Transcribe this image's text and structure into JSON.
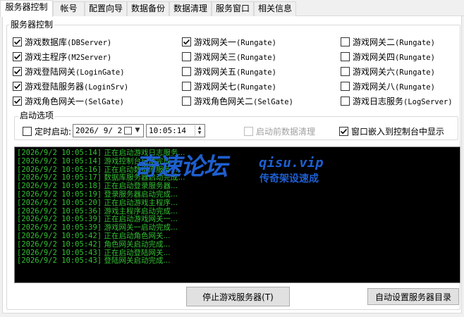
{
  "tabs": [
    {
      "label": "服务器控制"
    },
    {
      "label": "帐号"
    },
    {
      "label": "配置向导"
    },
    {
      "label": "数据备份"
    },
    {
      "label": "数据清理"
    },
    {
      "label": "服务窗口"
    },
    {
      "label": "相关信息"
    }
  ],
  "server_group": {
    "title": "服务器控制",
    "servers": [
      {
        "label": "游戏数据库",
        "code": "(DBServer)",
        "checked": true
      },
      {
        "label": "游戏网关一",
        "code": "(Rungate)",
        "checked": true
      },
      {
        "label": "游戏网关二",
        "code": "(Rungate)",
        "checked": false
      },
      {
        "label": "游戏主程序",
        "code": "(M2Server)",
        "checked": true
      },
      {
        "label": "游戏网关三",
        "code": "(Rungate)",
        "checked": false
      },
      {
        "label": "游戏网关四",
        "code": "(Rungate)",
        "checked": false
      },
      {
        "label": "游戏登陆网关",
        "code": "(LoginGate)",
        "checked": true
      },
      {
        "label": "游戏网关五",
        "code": "(Rungate)",
        "checked": false
      },
      {
        "label": "游戏网关六",
        "code": "(Rungate)",
        "checked": false
      },
      {
        "label": "游戏登陆服务器",
        "code": "(LoginSrv)",
        "checked": true
      },
      {
        "label": "游戏网关七",
        "code": "(Rungate)",
        "checked": false
      },
      {
        "label": "游戏网关八",
        "code": "(Rungate)",
        "checked": false
      },
      {
        "label": "游戏角色网关一",
        "code": "(SelGate)",
        "checked": true
      },
      {
        "label": "游戏角色网关二",
        "code": "(SelGate)",
        "checked": false
      },
      {
        "label": "游戏日志服务",
        "code": "(LogServer)",
        "checked": false
      }
    ]
  },
  "startup": {
    "title": "启动选项",
    "timed_start": {
      "label": "定时启动:",
      "checked": false
    },
    "date_value": "2026/ 9/ 2",
    "time_value": "10:05:14",
    "pre_clean": {
      "label": "启动前数据清理",
      "checked": false,
      "disabled": true
    },
    "embed_window": {
      "label": "窗口嵌入到控制台中显示",
      "checked": true
    }
  },
  "log": [
    {
      "time": "[2026/9/2 10:05:14]",
      "msg": "正在启动游戏日志服务..."
    },
    {
      "time": "[2026/9/2 10:05:14]",
      "msg": "游戏控制台启动完成..."
    },
    {
      "time": "[2026/9/2 10:05:16]",
      "msg": "正在启动数据库服务..."
    },
    {
      "time": "[2026/9/2 10:05:17]",
      "msg": "数据库服务器启动完成..."
    },
    {
      "time": "[2026/9/2 10:05:18]",
      "msg": "正在启动登录服务器..."
    },
    {
      "time": "[2026/9/2 10:05:19]",
      "msg": "登录服务器启动完成..."
    },
    {
      "time": "[2026/9/2 10:05:20]",
      "msg": "正在启动游戏主程序..."
    },
    {
      "time": "[2026/9/2 10:05:36]",
      "msg": "游戏主程序启动完成..."
    },
    {
      "time": "[2026/9/2 10:05:39]",
      "msg": "正在启动游戏网关一..."
    },
    {
      "time": "[2026/9/2 10:05:39]",
      "msg": "游戏网关一启动完成..."
    },
    {
      "time": "[2026/9/2 10:05:42]",
      "msg": "正在启动角色网关..."
    },
    {
      "time": "[2026/9/2 10:05:42]",
      "msg": "角色网关启动完成..."
    },
    {
      "time": "[2026/9/2 10:05:43]",
      "msg": "正在启动登陆网关..."
    },
    {
      "time": "[2026/9/2 10:05:43]",
      "msg": "登陆网关启动完成..."
    }
  ],
  "watermark": {
    "logo": "奇速论坛",
    "url": "qisu.vip",
    "slogan": "传奇架设速成"
  },
  "buttons": {
    "stop_server": "停止游戏服务器(T)",
    "auto_dir": "自动设置服务器目录"
  },
  "colors": {
    "log_text": "#33c233",
    "console_bg": "#000000",
    "watermark": "#1e5fd0"
  }
}
